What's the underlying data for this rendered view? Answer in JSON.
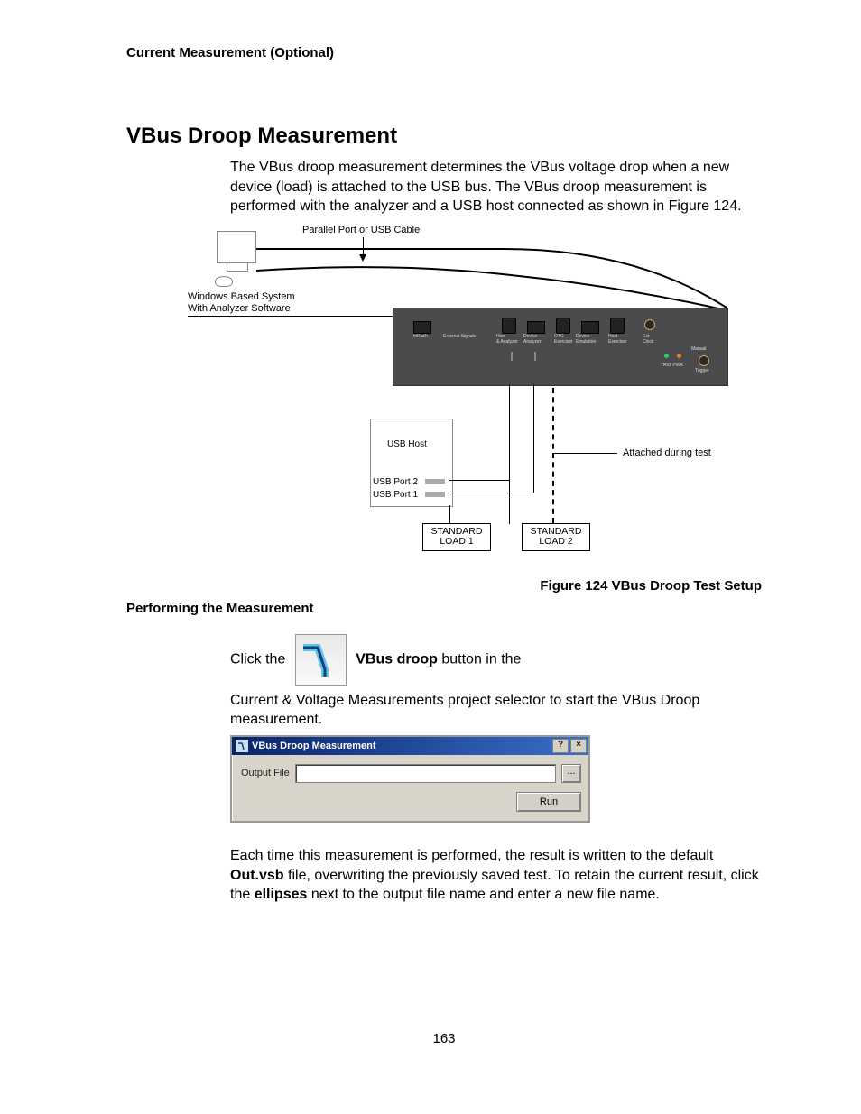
{
  "header": "Current Measurement (Optional)",
  "section_title": "VBus Droop Measurement",
  "intro": "The VBus droop measurement determines the VBus voltage drop when a new device (load) is attached to the USB bus. The VBus droop measurement is performed with the analyzer and a USB host connected as shown in Figure 124.",
  "diagram": {
    "parallel_label": "Parallel Port or USB Cable",
    "windows_label_l1": "Windows Based System",
    "windows_label_l2": "With Analyzer Software",
    "usb_host": "USB Host",
    "usb_port2": "USB Port 2",
    "usb_port1": "USB Port 1",
    "load1_l1": "STANDARD",
    "load1_l2": "LOAD 1",
    "load2_l1": "STANDARD",
    "load2_l2": "LOAD 2",
    "attached": "Attached during test",
    "analyzer_labels": {
      "inrush": "InRush",
      "external": "External Signals",
      "host_analyzer": "Host\n& Analyzer",
      "device_analyzer": "Device\nAnalyzer",
      "otg_exerciser": "OTG\nExerciser",
      "device_emulation": "Device\nEmulation",
      "host_exerciser": "Host\nExerciser",
      "ext_clock": "Ext\nClock",
      "manual": "Manual",
      "trig_pwr": "TRIG PWR",
      "trigger": "Trigger"
    }
  },
  "figure_caption": "Figure  124  VBus Droop Test Setup",
  "subhead": "Performing the Measurement",
  "click_the": "Click the ",
  "vbus_droop_bold": "VBus droop",
  "click_tail": " button in the",
  "click_para2": "Current & Voltage Measurements project selector to start the VBus Droop measurement.",
  "dialog": {
    "title": "VBus Droop Measurement",
    "help": "?",
    "close": "×",
    "output_file": "Output File",
    "ellipses": "...",
    "run": "Run"
  },
  "para3_pre": "Each time this measurement is performed, the result is written to the default ",
  "para3_bold1": "Out.vsb",
  "para3_mid": " file, overwriting the previously saved test. To retain the current result, click the ",
  "para3_bold2": "ellipses",
  "para3_tail": " next to the output file name and enter a new file name.",
  "page_num": "163"
}
